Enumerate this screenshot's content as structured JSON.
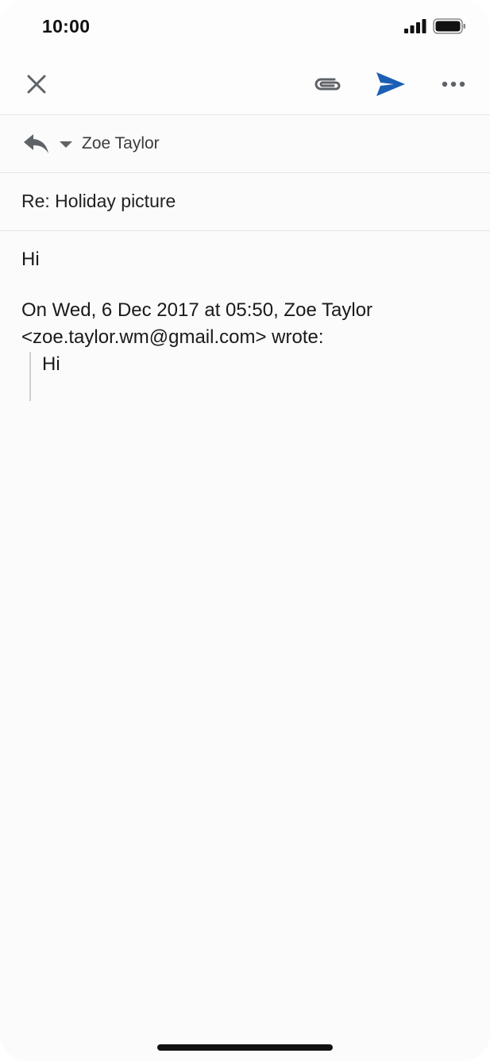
{
  "status_bar": {
    "time": "10:00",
    "signal_icon": "cellular-signal-icon",
    "battery_icon": "battery-icon"
  },
  "toolbar": {
    "close_icon": "close-icon",
    "attach_icon": "paperclip-icon",
    "send_icon": "send-icon",
    "more_icon": "more-horizontal-icon",
    "send_color": "#1a5fb4"
  },
  "compose": {
    "reply_icon": "reply-icon",
    "dropdown_icon": "caret-down-icon",
    "from_name": "Zoe Taylor",
    "subject": "Re: Holiday picture",
    "body": "Hi",
    "quote_header_line1": "On Wed, 6 Dec 2017 at 05:50, Zoe Taylor",
    "quote_header_line2": "<zoe.taylor.wm@gmail.com> wrote:",
    "quoted_text": "Hi"
  }
}
